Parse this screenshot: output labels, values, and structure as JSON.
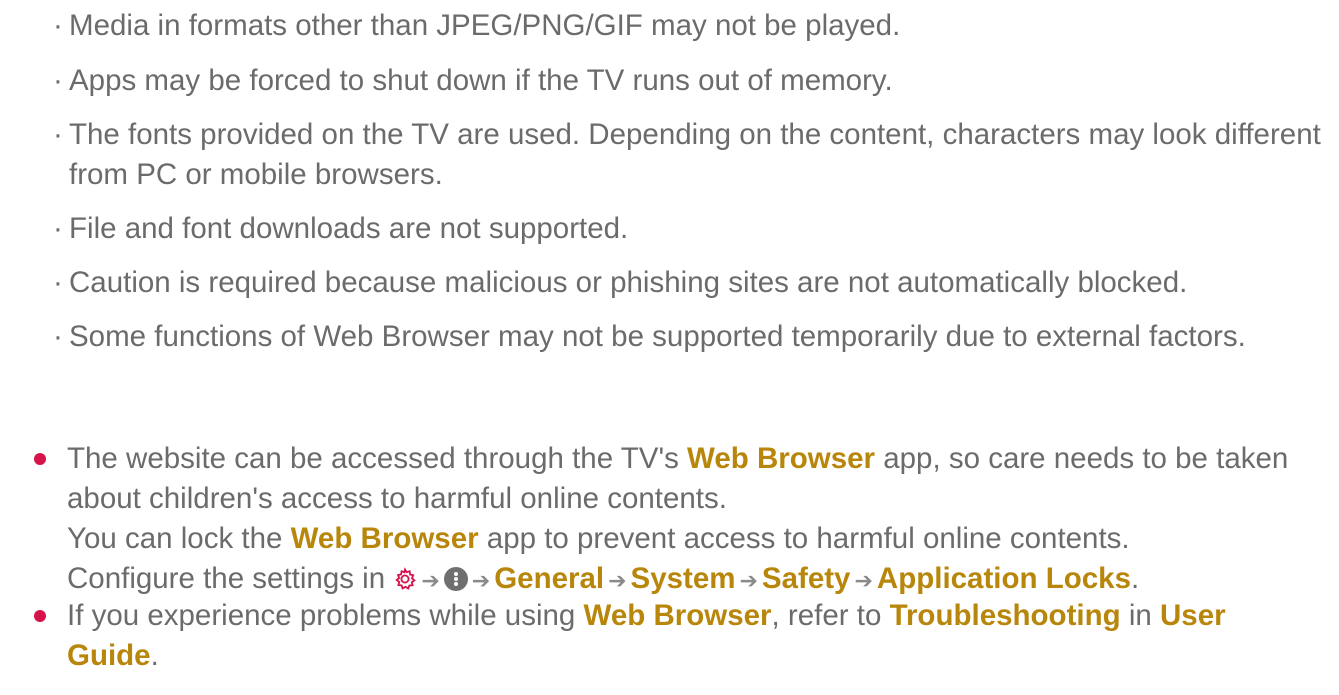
{
  "sub_items": [
    "Media in formats other than JPEG/PNG/GIF may not be played.",
    "Apps may be forced to shut down if the TV runs out of memory.",
    "The fonts provided on the TV are used. Depending on the content, characters may look different from PC or mobile browsers.",
    "File and font downloads are not supported.",
    "Caution is required because malicious or phishing sites are not automatically blocked.",
    "Some functions of Web Browser may not be supported temporarily due to external factors."
  ],
  "sub_bullet": "·",
  "note1": {
    "line1_pre": "The website can be accessed through the TV's ",
    "line1_hl": "Web Browser",
    "line1_post": " app, so care needs to be taken about children's access to harmful online contents.",
    "line2_pre": "You can lock the ",
    "line2_hl": "Web Browser",
    "line2_post": " app to prevent access to harmful online contents.",
    "line3_pre": "Configure the settings in ",
    "path": [
      "General",
      "System",
      "Safety",
      "Application Locks"
    ],
    "line3_end": "."
  },
  "note2": {
    "pre": "If you experience problems while using ",
    "hl1": "Web Browser",
    "mid": ", refer to ",
    "hl2": "Troubleshooting",
    "mid2": " in ",
    "hl3": "User Guide",
    "end": "."
  },
  "arrow": "➔",
  "colors": {
    "text": "#6b6b6b",
    "highlight": "#b8860b",
    "bullet": "#d6124a",
    "gear": "#d6124a"
  },
  "icons": [
    "gear-icon",
    "more-options-icon"
  ]
}
